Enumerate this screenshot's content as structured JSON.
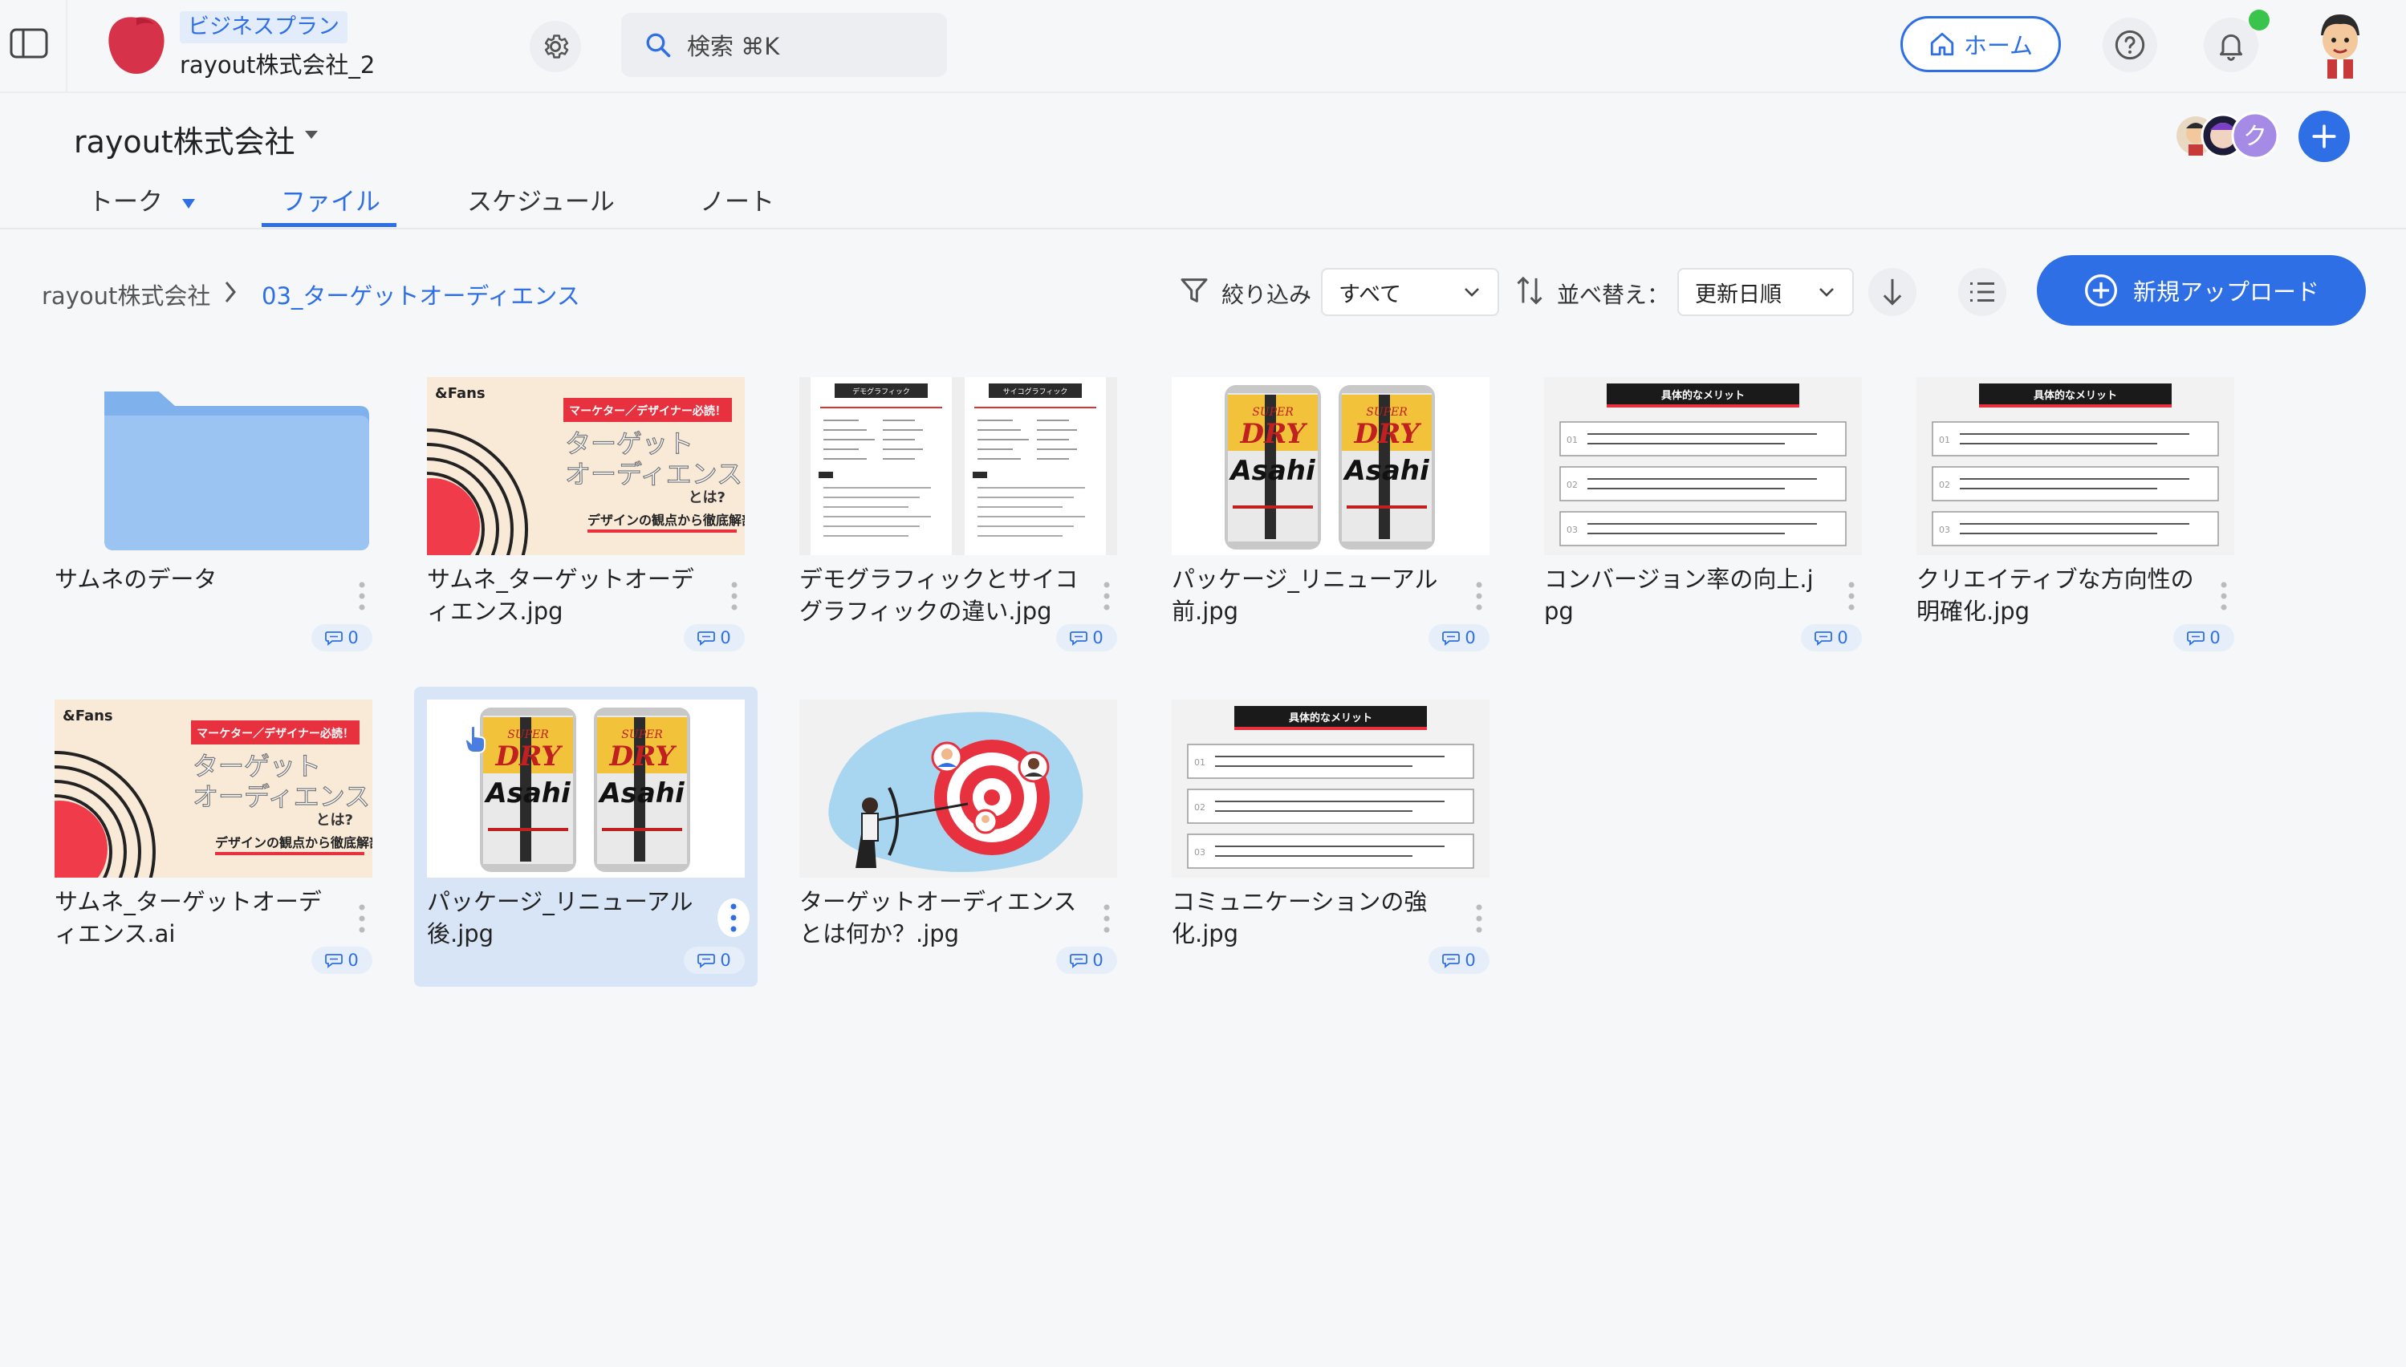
{
  "header": {
    "plan_badge": "ビジネスプラン",
    "workspace_name": "rayout株式会社_2",
    "search_label": "検索 ⌘K",
    "home_label": "ホーム",
    "brand_color": "#2f6fe6"
  },
  "channel": {
    "title": "rayout株式会社",
    "member_initial": "ク",
    "tabs": [
      {
        "label": "トーク",
        "active": false
      },
      {
        "label": "ファイル",
        "active": true
      },
      {
        "label": "スケジュール",
        "active": false
      },
      {
        "label": "ノート",
        "active": false
      }
    ]
  },
  "toolbar": {
    "breadcrumb": [
      "rayout株式会社",
      "03_ターゲットオーディエンス"
    ],
    "filter_label": "絞り込み",
    "filter_value": "すべて",
    "sort_label": "並べ替え：",
    "sort_value": "更新日順",
    "upload_label": "新規アップロード"
  },
  "files": [
    {
      "name": "サムネのデータ",
      "type": "folder",
      "comments": "0"
    },
    {
      "name": "サムネ_ターゲットオーディエンス.jpg",
      "type": "thumb-target",
      "comments": "0",
      "thumb_text": {
        "brand": "&Fans",
        "banner": "マーケター／デザイナー必読！",
        "line1": "ターゲット",
        "line2": "オーディエンス",
        "sub": "とは?",
        "foot": "デザインの観点から徹底解剖"
      }
    },
    {
      "name": "デモグラフィックとサイコグラフィックの違い.jpg",
      "type": "thumb-doc2",
      "comments": "0",
      "thumb_text": {
        "left_head": "デモグラフィック",
        "right_head": "サイコグラフィック"
      }
    },
    {
      "name": "パッケージ_リニューアル前.jpg",
      "type": "thumb-cans",
      "comments": "0",
      "thumb_text": {
        "brand": "Asahi",
        "top": "SUPER",
        "main": "DRY"
      }
    },
    {
      "name": "コンバージョン率の向上.jpg",
      "type": "thumb-merit",
      "comments": "0",
      "thumb_text": {
        "head": "具体的なメリット"
      }
    },
    {
      "name": "クリエイティブな方向性の明確化.jpg",
      "type": "thumb-merit",
      "comments": "0",
      "thumb_text": {
        "head": "具体的なメリット"
      }
    },
    {
      "name": "サムネ_ターゲットオーディエンス.ai",
      "type": "thumb-target",
      "comments": "0",
      "thumb_text": {
        "brand": "&Fans",
        "banner": "マーケター／デザイナー必読！",
        "line1": "ターゲット",
        "line2": "オーディエンス",
        "sub": "とは?",
        "foot": "デザインの観点から徹底解剖"
      }
    },
    {
      "name": "パッケージ_リニューアル後.jpg",
      "type": "thumb-cans",
      "comments": "0",
      "selected": true,
      "thumb_text": {
        "brand": "Asahi",
        "top": "SUPER",
        "main": "DRY"
      }
    },
    {
      "name": "ターゲットオーディエンスとは何か？.jpg",
      "type": "thumb-archer",
      "comments": "0"
    },
    {
      "name": "コミュニケーションの強化.jpg",
      "type": "thumb-merit",
      "comments": "0",
      "thumb_text": {
        "head": "具体的なメリット"
      }
    }
  ]
}
